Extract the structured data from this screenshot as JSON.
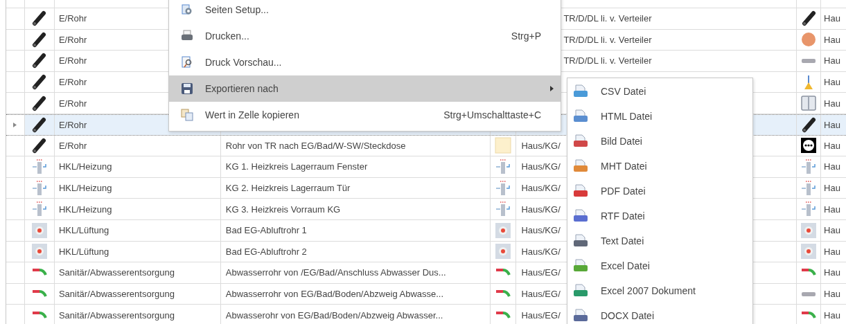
{
  "table": {
    "rows": [
      {
        "selected": false,
        "icon": {
          "kind": "pipe"
        },
        "type": "E/Rohr",
        "location": "TR/D/DL li. v. Verteiler",
        "icon_3": {
          "kind": "pipe"
        },
        "column_8": "Hau"
      },
      {
        "selected": false,
        "icon": {
          "kind": "pipe"
        },
        "type": "E/Rohr",
        "location": "TR/D/DL li. v. Verteiler",
        "icon_3": {
          "kind": "disc"
        },
        "column_8": "Hau"
      },
      {
        "selected": false,
        "icon": {
          "kind": "pipe"
        },
        "type": "E/Rohr",
        "location": "TR/D/DL li. v. Verteiler",
        "icon_3": {
          "kind": "bar"
        },
        "column_8": "Hau"
      },
      {
        "selected": false,
        "icon": {
          "kind": "pipe"
        },
        "type": "E/Rohr",
        "icon_3": {
          "kind": "lamp"
        },
        "column_8": "Hau"
      },
      {
        "selected": false,
        "icon": {
          "kind": "pipe"
        },
        "type": "E/Rohr",
        "icon_3": {
          "kind": "switch"
        },
        "column_8": "Hau"
      },
      {
        "selected": true,
        "icon": {
          "kind": "pipe"
        },
        "type": "E/Rohr",
        "icon_3": {
          "kind": "pipe"
        },
        "column_8": "Hau"
      },
      {
        "selected": false,
        "icon": {
          "kind": "pipe"
        },
        "type": "E/Rohr",
        "description": "Rohr von TR nach EG/Bad/W-SW/Steckdose",
        "icon_2": {
          "kind": "note"
        },
        "location": "Haus/KG/",
        "icon_3": {
          "kind": "socket"
        },
        "column_8": "Hau"
      },
      {
        "selected": false,
        "icon": {
          "kind": "radiator"
        },
        "type": "HKL/Heizung",
        "description": "KG 1. Heizkreis Lagerraum Fenster",
        "icon_2": {
          "kind": "radiator"
        },
        "location": "Haus/KG/",
        "icon_3": {
          "kind": "radiator"
        },
        "column_8": "Hau"
      },
      {
        "selected": false,
        "icon": {
          "kind": "radiator"
        },
        "type": "HKL/Heizung",
        "description": "KG 2. Heizkreis Lagerraum Tür",
        "icon_2": {
          "kind": "radiator"
        },
        "location": "Haus/KG/",
        "icon_3": {
          "kind": "radiator"
        },
        "column_8": "Hau"
      },
      {
        "selected": false,
        "icon": {
          "kind": "radiator"
        },
        "type": "HKL/Heizung",
        "description": "KG 3. Heizkreis Vorraum KG",
        "icon_2": {
          "kind": "radiator"
        },
        "location": "Haus/KG/",
        "icon_3": {
          "kind": "radiator"
        },
        "column_8": "Hau"
      },
      {
        "selected": false,
        "icon": {
          "kind": "vent"
        },
        "type": "HKL/Lüftung",
        "description": "Bad EG-Abluftrohr 1",
        "icon_2": {
          "kind": "vent"
        },
        "location": "Haus/KG/",
        "icon_3": {
          "kind": "vent"
        },
        "column_8": "Hau"
      },
      {
        "selected": false,
        "icon": {
          "kind": "vent"
        },
        "type": "HKL/Lüftung",
        "description": "Bad EG-Abluftrohr 2",
        "icon_2": {
          "kind": "vent"
        },
        "location": "Haus/KG/",
        "icon_3": {
          "kind": "vent"
        },
        "column_8": "Hau"
      },
      {
        "selected": false,
        "icon": {
          "kind": "elbow"
        },
        "type": "Sanitär/Abwasserentsorgung",
        "description": "Abwasserrohr von /EG/Bad/Anschluss Abwasser Dus...",
        "icon_2": {
          "kind": "elbow"
        },
        "location": "Haus/EG/",
        "icon_3": {
          "kind": "elbow"
        },
        "column_8": "Hau"
      },
      {
        "selected": false,
        "icon": {
          "kind": "elbow"
        },
        "type": "Sanitär/Abwasserentsorgung",
        "description": "Abwasserrohr von EG/Bad/Boden/Abzweig Abwasse...",
        "icon_2": {
          "kind": "elbow"
        },
        "location": "Haus/EG/",
        "icon_3": {
          "kind": "bar"
        },
        "column_8": "Hau"
      },
      {
        "selected": false,
        "icon": {
          "kind": "elbow"
        },
        "type": "Sanitär/Abwasserentsorgung",
        "description": "Abwasserohr von EG/Bad/Boden/Abzweig Abwasser...",
        "icon_2": {
          "kind": "elbow"
        },
        "location": "Haus/EG/",
        "icon_3": {
          "kind": "elbow"
        },
        "column_8": "Hau"
      }
    ]
  },
  "context_menu": {
    "items": [
      {
        "icon": {
          "kind": "page-setup"
        },
        "label": "Seiten Setup...",
        "selected": false,
        "has_submenu": false
      },
      {
        "icon": {
          "kind": "printer"
        },
        "label": "Drucken...",
        "shortcut": "Strg+P",
        "selected": false,
        "has_submenu": false
      },
      {
        "icon": {
          "kind": "print-preview"
        },
        "label": "Druck Vorschau...",
        "selected": false,
        "has_submenu": false
      },
      {
        "icon": {
          "kind": "floppy-disk"
        },
        "label": "Exportieren nach",
        "selected": true,
        "has_submenu": true
      },
      {
        "icon": {
          "kind": "copy"
        },
        "label": "Wert in Zelle kopieren",
        "shortcut": "Strg+Umschalttaste+C",
        "selected": false,
        "has_submenu": false
      }
    ]
  },
  "submenu": {
    "items": [
      {
        "label": "CSV Datei",
        "color": "#4a9ad8"
      },
      {
        "label": "HTML Datei",
        "color": "#5a8ed0"
      },
      {
        "label": "Bild Datei",
        "color": "#d04848"
      },
      {
        "label": "MHT Datei",
        "color": "#e08a3a"
      },
      {
        "label": "PDF Datei",
        "color": "#d83a3a"
      },
      {
        "label": "RTF Datei",
        "color": "#5a6ed0"
      },
      {
        "label": "Text Datei",
        "color": "#606878"
      },
      {
        "label": "Excel Datei",
        "color": "#58a838"
      },
      {
        "label": "Excel 2007 Dokument",
        "color": "#2a9a6a"
      },
      {
        "label": "DOCX Datei",
        "color": "#5a6a9a"
      }
    ]
  }
}
